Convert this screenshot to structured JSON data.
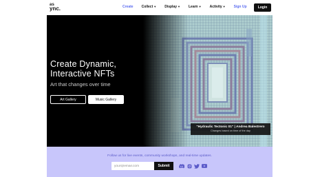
{
  "brand": {
    "logo_top": "as",
    "logo_bottom": "ync."
  },
  "nav": {
    "items": [
      {
        "label": "Create",
        "has_dropdown": false,
        "active": true
      },
      {
        "label": "Collect",
        "has_dropdown": true
      },
      {
        "label": "Display",
        "has_dropdown": true
      },
      {
        "label": "Learn",
        "has_dropdown": true
      },
      {
        "label": "Activity",
        "has_dropdown": true
      }
    ],
    "signup_label": "Sign Up",
    "login_label": "Login"
  },
  "hero": {
    "title_line1": "Create Dynamic,",
    "title_line2": "Interactive NFTs",
    "subtitle": "Art that changes over time",
    "primary_button": "Art Gallery",
    "secondary_button": "Music Gallery",
    "caption_title": "\"Hydraulic Tectonic 01\" | Andrea Balestrero",
    "caption_sub": "Changes based on time of the day"
  },
  "newsletter": {
    "text": "Follow us for live events, community workshops, and real-time updates.",
    "email_placeholder": "your@email.com",
    "submit_label": "Submit",
    "socials": [
      "discord-icon",
      "instagram-icon",
      "twitter-icon",
      "youtube-icon"
    ]
  },
  "colors": {
    "accent": "#5b6cf0",
    "newsletter_bg": "#c8c6fb",
    "dark": "#111111"
  }
}
